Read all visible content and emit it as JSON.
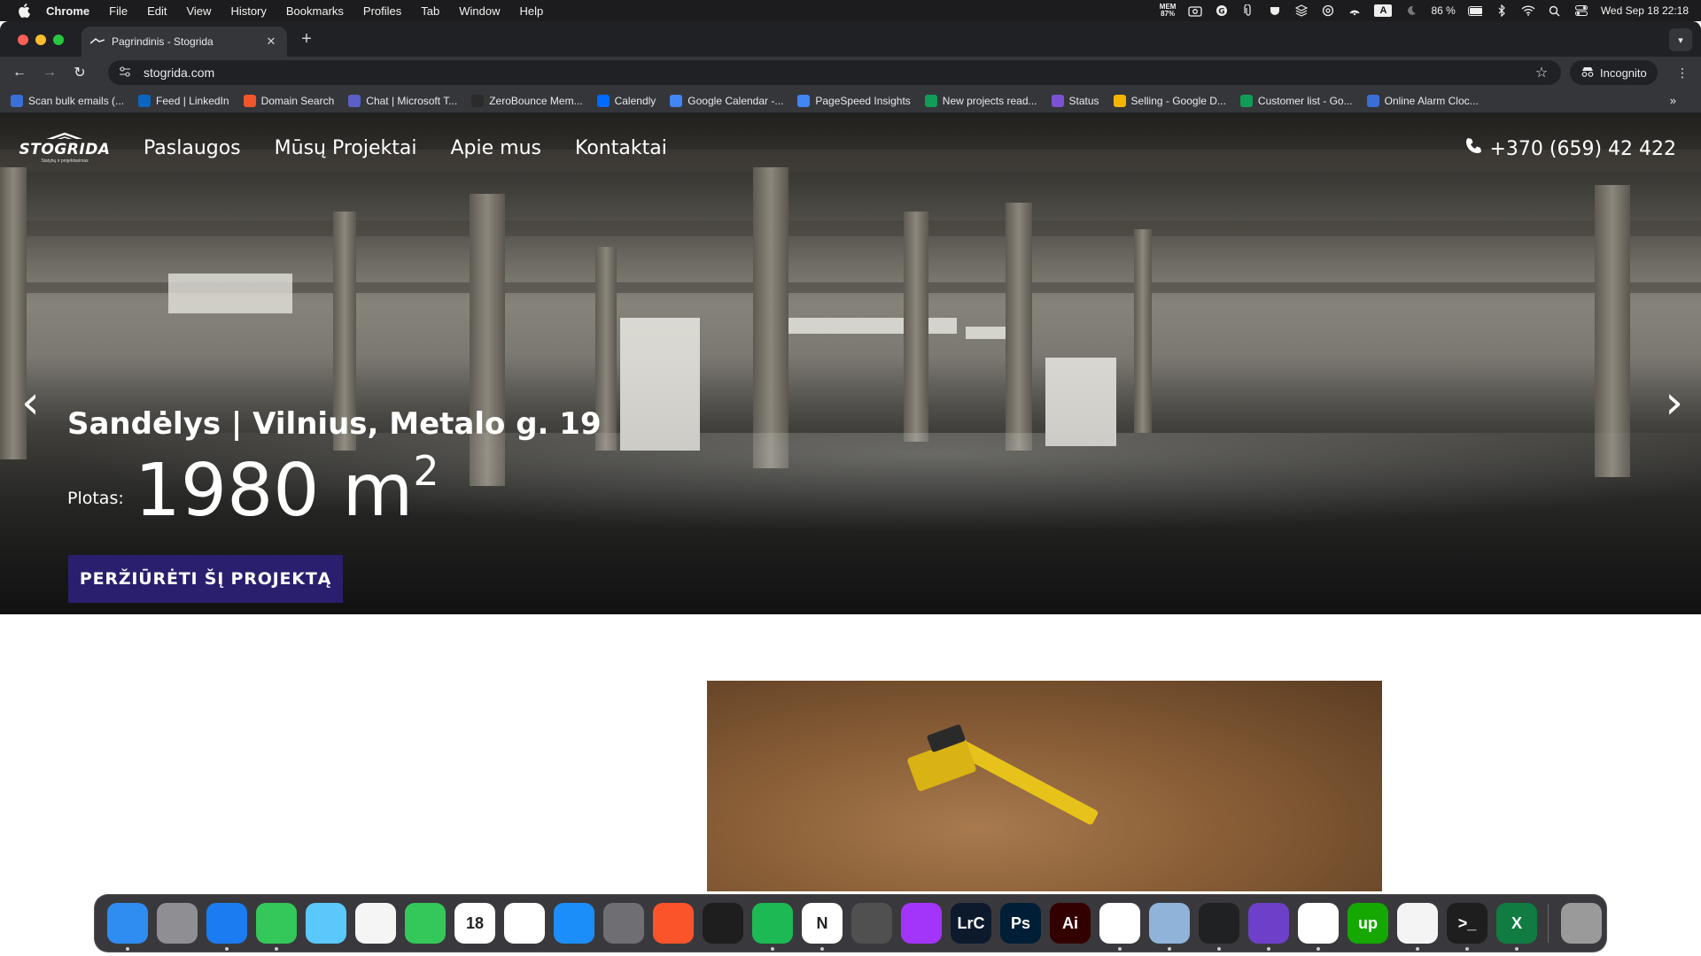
{
  "menubar": {
    "app_name": "Chrome",
    "menus": [
      "File",
      "Edit",
      "View",
      "History",
      "Bookmarks",
      "Profiles",
      "Tab",
      "Window",
      "Help"
    ],
    "mem_label": "MEM",
    "mem_value": "87%",
    "battery": "86 %",
    "datetime": "Wed Sep 18  22:18",
    "input_source": "A"
  },
  "browser": {
    "tab_title": "Pagrindinis - Stogrida",
    "url": "stogrida.com",
    "incognito_label": "Incognito",
    "bookmarks": [
      {
        "label": "Scan bulk emails (...",
        "icon": "scan-icon",
        "color": "#3b6fd8"
      },
      {
        "label": "Feed | LinkedIn",
        "icon": "linkedin-icon",
        "color": "#0a66c2"
      },
      {
        "label": "Domain Search",
        "icon": "hunter-icon",
        "color": "#f0552c"
      },
      {
        "label": "Chat | Microsoft T...",
        "icon": "teams-icon",
        "color": "#5b5fc7"
      },
      {
        "label": "ZeroBounce Mem...",
        "icon": "zerobounce-icon",
        "color": "#2b2b2b"
      },
      {
        "label": "Calendly",
        "icon": "calendly-icon",
        "color": "#006bff"
      },
      {
        "label": "Google Calendar -...",
        "icon": "calendar-icon",
        "color": "#4285f4"
      },
      {
        "label": "PageSpeed Insights",
        "icon": "pagespeed-icon",
        "color": "#4285f4"
      },
      {
        "label": "New projects read...",
        "icon": "sheets-icon",
        "color": "#0f9d58"
      },
      {
        "label": "Status",
        "icon": "status-icon",
        "color": "#7b52d3"
      },
      {
        "label": "Selling - Google D...",
        "icon": "drive-icon",
        "color": "#f4b400"
      },
      {
        "label": "Customer list - Go...",
        "icon": "sheets-icon",
        "color": "#0f9d58"
      },
      {
        "label": "Online Alarm Cloc...",
        "icon": "alarm-icon",
        "color": "#3b6fd8"
      }
    ]
  },
  "site": {
    "logo_text": "STOGRIDA",
    "logo_sub": "Statybų ir projektavimas",
    "nav": [
      "Paslaugos",
      "Mūsų Projektai",
      "Apie mus",
      "Kontaktai"
    ],
    "phone": "+370 (659) 42 422",
    "slide": {
      "title": "Sandėlys | Vilnius, Metalo g. 19",
      "area_label": "Plotas:",
      "area_value": "1980 m",
      "area_sup": "2",
      "cta": "PERŽIŪRĖTI ŠĮ PROJEKTĄ"
    },
    "arrow_prev": "‹",
    "arrow_next": "›"
  },
  "dock": [
    {
      "name": "finder",
      "label": "",
      "color": "#2f8cf0",
      "running": true
    },
    {
      "name": "launchpad",
      "label": "",
      "color": "#8e8e93",
      "running": false
    },
    {
      "name": "safari",
      "label": "",
      "color": "#1b7bf0",
      "running": true
    },
    {
      "name": "messages",
      "label": "",
      "color": "#34c759",
      "running": true
    },
    {
      "name": "maps",
      "label": "",
      "color": "#5ac8fa",
      "running": false
    },
    {
      "name": "photos",
      "label": "",
      "color": "#f5f5f5",
      "running": false
    },
    {
      "name": "facetime",
      "label": "",
      "color": "#34c759",
      "running": false
    },
    {
      "name": "calendar",
      "label": "18",
      "color": "#ffffff",
      "running": false
    },
    {
      "name": "reminders",
      "label": "",
      "color": "#ffffff",
      "running": false
    },
    {
      "name": "app-store",
      "label": "",
      "color": "#1c8ef9",
      "running": false
    },
    {
      "name": "system-settings",
      "label": "",
      "color": "#6e6e73",
      "running": false
    },
    {
      "name": "brave",
      "label": "",
      "color": "#fb542b",
      "running": false
    },
    {
      "name": "figma",
      "label": "",
      "color": "#1e1e1e",
      "running": false
    },
    {
      "name": "spotify",
      "label": "",
      "color": "#1db954",
      "running": true
    },
    {
      "name": "notion",
      "label": "N",
      "color": "#ffffff",
      "running": true
    },
    {
      "name": "calculator",
      "label": "",
      "color": "#505050",
      "running": false
    },
    {
      "name": "messenger",
      "label": "",
      "color": "#a334fa",
      "running": false
    },
    {
      "name": "lightroom",
      "label": "LrC",
      "color": "#0d1a2e",
      "running": false
    },
    {
      "name": "photoshop",
      "label": "Ps",
      "color": "#001e36",
      "running": false
    },
    {
      "name": "illustrator",
      "label": "Ai",
      "color": "#330000",
      "running": false
    },
    {
      "name": "chrome",
      "label": "",
      "color": "#ffffff",
      "running": true
    },
    {
      "name": "preview",
      "label": "",
      "color": "#8fb3d9",
      "running": true
    },
    {
      "name": "chatgpt",
      "label": "",
      "color": "#202123",
      "running": true
    },
    {
      "name": "github-desktop",
      "label": "",
      "color": "#6e40c9",
      "running": true
    },
    {
      "name": "vscode",
      "label": "",
      "color": "#ffffff",
      "running": true
    },
    {
      "name": "upwork",
      "label": "up",
      "color": "#14a800",
      "running": false
    },
    {
      "name": "textedit",
      "label": "",
      "color": "#f4f4f4",
      "running": true
    },
    {
      "name": "terminal",
      "label": ">_",
      "color": "#1e1e1e",
      "running": true
    },
    {
      "name": "excel",
      "label": "X",
      "color": "#107c41",
      "running": true
    },
    {
      "name": "trash",
      "label": "",
      "color": "#9a9a9a",
      "running": false
    }
  ]
}
